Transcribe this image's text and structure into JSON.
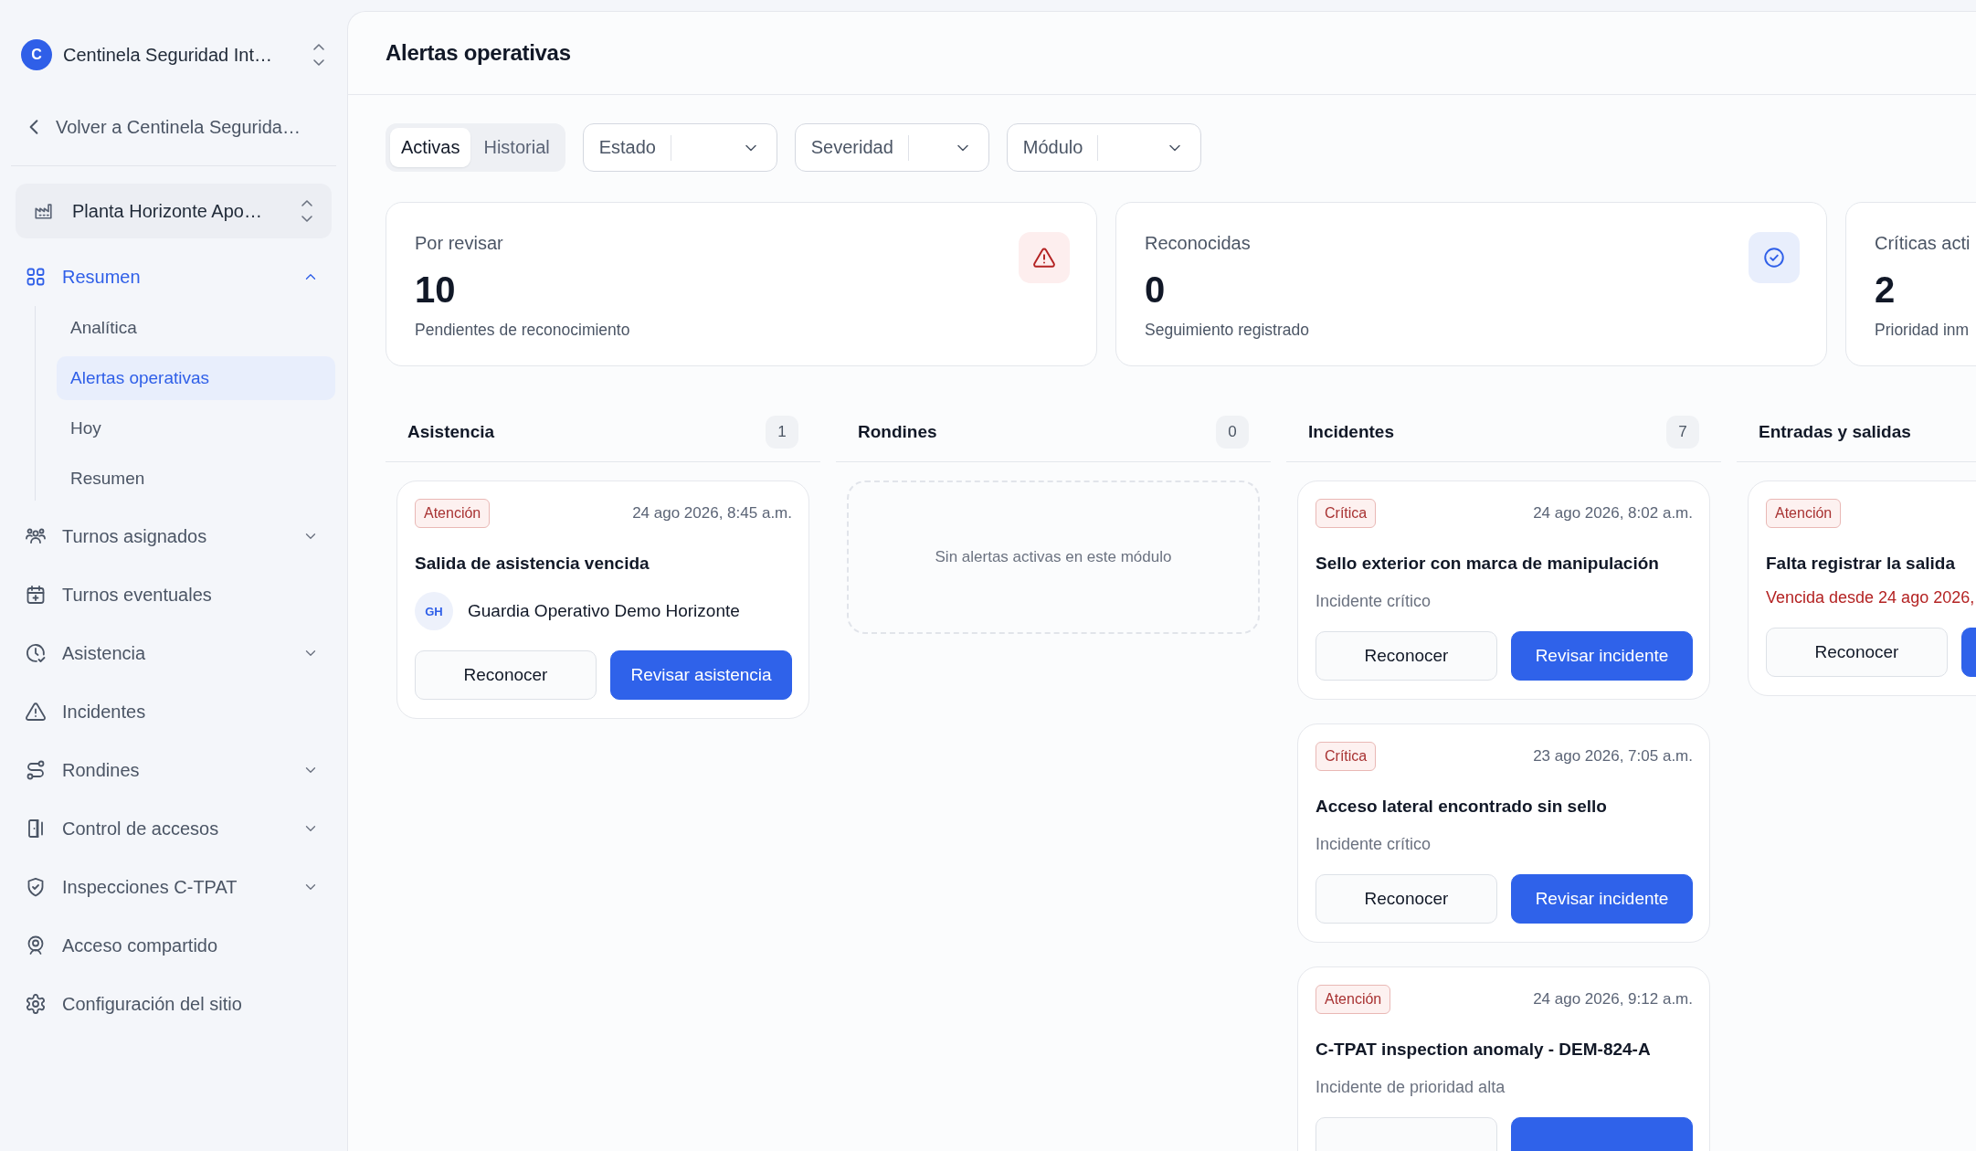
{
  "org_switcher": {
    "avatar": "C",
    "name": "Centinela Seguridad Int…"
  },
  "back_link": {
    "label": "Volver a Centinela Segurida…"
  },
  "site_switcher": {
    "name": "Planta Horizonte Apo…"
  },
  "nav": [
    {
      "label": "Resumen",
      "kind": "group",
      "selected": true,
      "expanded": true,
      "children": [
        {
          "label": "Analítica",
          "selected": false
        },
        {
          "label": "Alertas operativas",
          "selected": true
        },
        {
          "label": "Hoy",
          "selected": false
        },
        {
          "label": "Resumen",
          "selected": false
        }
      ]
    },
    {
      "label": "Turnos asignados",
      "kind": "group",
      "selected": false,
      "expanded": false
    },
    {
      "label": "Turnos eventuales",
      "kind": "link",
      "selected": false
    },
    {
      "label": "Asistencia",
      "kind": "group",
      "selected": false,
      "expanded": false
    },
    {
      "label": "Incidentes",
      "kind": "link",
      "selected": false
    },
    {
      "label": "Rondines",
      "kind": "group",
      "selected": false,
      "expanded": false
    },
    {
      "label": "Control de accesos",
      "kind": "group",
      "selected": false,
      "expanded": false
    },
    {
      "label": "Inspecciones C-TPAT",
      "kind": "group",
      "selected": false,
      "expanded": false
    },
    {
      "label": "Acceso compartido",
      "kind": "link",
      "selected": false
    },
    {
      "label": "Configuración del sitio",
      "kind": "link",
      "selected": false
    }
  ],
  "page_title": "Alertas operativas",
  "view_tabs": [
    {
      "label": "Activas",
      "selected": true
    },
    {
      "label": "Historial",
      "selected": false
    }
  ],
  "filters": [
    {
      "label": "Estado"
    },
    {
      "label": "Severidad"
    },
    {
      "label": "Módulo"
    }
  ],
  "stats": [
    {
      "kind": "pending",
      "label": "Por revisar",
      "value": "10",
      "caption": "Pendientes de reconocimiento"
    },
    {
      "kind": "acknowledged",
      "label": "Reconocidas",
      "value": "0",
      "caption": "Seguimiento registrado"
    },
    {
      "kind": "critical",
      "label": "Críticas acti",
      "value": "2",
      "caption": "Prioridad inm"
    }
  ],
  "columns": [
    {
      "title": "Asistencia",
      "count": "1",
      "alerts": [
        {
          "severity": "Atención",
          "time": "24 ago 2026, 8:45 a.m.",
          "title": "Salida de asistencia vencida",
          "person": {
            "initials": "GH",
            "name": "Guardia Operativo Demo Horizonte"
          },
          "actions": [
            {
              "kind": "acknowledge",
              "label": "Reconocer"
            },
            {
              "kind": "review",
              "label": "Revisar asistencia"
            }
          ]
        }
      ]
    },
    {
      "title": "Rondines",
      "count": "0",
      "empty_message": "Sin alertas activas en este módulo"
    },
    {
      "title": "Incidentes",
      "count": "7",
      "alerts": [
        {
          "severity": "Crítica",
          "time": "24 ago 2026, 8:02 a.m.",
          "title": "Sello exterior con marca de manipulación",
          "detail": "Incidente crítico",
          "actions": [
            {
              "kind": "acknowledge",
              "label": "Reconocer"
            },
            {
              "kind": "review",
              "label": "Revisar incidente"
            }
          ]
        },
        {
          "severity": "Crítica",
          "time": "23 ago 2026, 7:05 a.m.",
          "title": "Acceso lateral encontrado sin sello",
          "detail": "Incidente crítico",
          "actions": [
            {
              "kind": "acknowledge",
              "label": "Reconocer"
            },
            {
              "kind": "review",
              "label": "Revisar incidente"
            }
          ]
        },
        {
          "severity": "Atención",
          "time": "24 ago 2026, 9:12 a.m.",
          "title": "C-TPAT inspection anomaly - DEM-824-A",
          "detail": "Incidente de prioridad alta",
          "actions": [
            {
              "kind": "acknowledge"
            },
            {
              "kind": "review"
            }
          ]
        }
      ]
    },
    {
      "title": "Entradas y salidas",
      "alerts": [
        {
          "severity": "Atención",
          "title": "Falta registrar la salida",
          "overdue": "Vencida desde 24 ago 2026,",
          "actions": [
            {
              "kind": "acknowledge",
              "label": "Reconocer"
            },
            {
              "kind": "review"
            }
          ]
        }
      ]
    }
  ]
}
